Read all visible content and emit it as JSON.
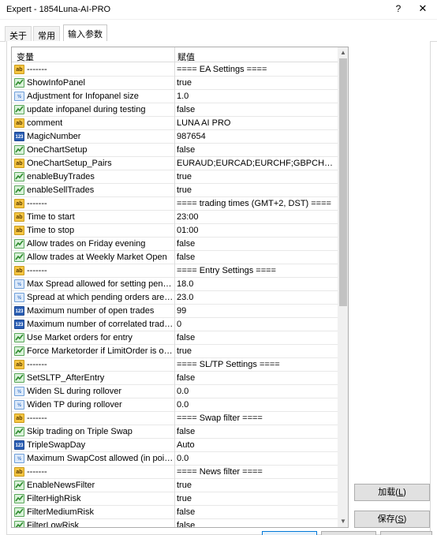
{
  "window": {
    "title": "Expert - 1854Luna-AI-PRO",
    "help_label": "?",
    "close_label": "✕"
  },
  "tabs": [
    {
      "label": "关于",
      "active": false
    },
    {
      "label": "常用",
      "active": false
    },
    {
      "label": "输入参数",
      "active": true
    }
  ],
  "grid": {
    "col_name": "变量",
    "col_value": "赋值",
    "rows": [
      {
        "type": "ab",
        "name": "-------",
        "value": "==== EA Settings ===="
      },
      {
        "type": "bool",
        "name": "ShowInfoPanel",
        "value": "true"
      },
      {
        "type": "dbl",
        "name": "Adjustment for Infopanel size",
        "value": "1.0"
      },
      {
        "type": "bool",
        "name": "update infopanel during testing",
        "value": "false"
      },
      {
        "type": "ab",
        "name": "comment",
        "value": "LUNA AI PRO"
      },
      {
        "type": "int",
        "name": "MagicNumber",
        "value": "987654"
      },
      {
        "type": "bool",
        "name": "OneChartSetup",
        "value": "false"
      },
      {
        "type": "ab",
        "name": "OneChartSetup_Pairs",
        "value": "EURAUD;EURCAD;EURCHF;GBPCHF;AUDU..."
      },
      {
        "type": "bool",
        "name": "enableBuyTrades",
        "value": "true"
      },
      {
        "type": "bool",
        "name": "enableSellTrades",
        "value": "true"
      },
      {
        "type": "ab",
        "name": "-------",
        "value": "==== trading times (GMT+2, DST) ===="
      },
      {
        "type": "ab",
        "name": "Time to start",
        "value": "23:00"
      },
      {
        "type": "ab",
        "name": "Time to stop",
        "value": "01:00"
      },
      {
        "type": "bool",
        "name": "Allow trades on Friday evening",
        "value": "false"
      },
      {
        "type": "bool",
        "name": "Allow trades at Weekly Market Open",
        "value": "false"
      },
      {
        "type": "ab",
        "name": "-------",
        "value": "==== Entry Settings ===="
      },
      {
        "type": "dbl",
        "name": "Max Spread allowed for setting pendi...",
        "value": "18.0"
      },
      {
        "type": "dbl",
        "name": "Spread at which pending orders are d...",
        "value": "23.0"
      },
      {
        "type": "int",
        "name": "Maximum number of open trades",
        "value": "99"
      },
      {
        "type": "int",
        "name": "Maximum number of correlated trade...",
        "value": "0"
      },
      {
        "type": "bool",
        "name": "Use Market orders for entry",
        "value": "false"
      },
      {
        "type": "bool",
        "name": "Force Marketorder if LimitOrder is ou...",
        "value": "true"
      },
      {
        "type": "ab",
        "name": "-------",
        "value": "==== SL/TP Settings ===="
      },
      {
        "type": "bool",
        "name": "SetSLTP_AfterEntry",
        "value": "false"
      },
      {
        "type": "dbl",
        "name": "Widen SL during rollover",
        "value": "0.0"
      },
      {
        "type": "dbl",
        "name": "Widen TP during rollover",
        "value": "0.0"
      },
      {
        "type": "ab",
        "name": "-------",
        "value": "==== Swap filter ===="
      },
      {
        "type": "bool",
        "name": "Skip trading on Triple Swap",
        "value": "false"
      },
      {
        "type": "int",
        "name": "TripleSwapDay",
        "value": "Auto"
      },
      {
        "type": "dbl",
        "name": "Maximum SwapCost allowed (in points)",
        "value": "0.0"
      },
      {
        "type": "ab",
        "name": "-------",
        "value": "==== News filter ===="
      },
      {
        "type": "bool",
        "name": "EnableNewsFilter",
        "value": "true"
      },
      {
        "type": "bool",
        "name": "FilterHighRisk",
        "value": "true"
      },
      {
        "type": "bool",
        "name": "FilterMediumRisk",
        "value": "false"
      },
      {
        "type": "bool",
        "name": "FilterLowRisk",
        "value": "false"
      }
    ]
  },
  "buttons": {
    "load_label": "加载(",
    "load_key": "L",
    "load_suffix": ")",
    "save_label": "保存(",
    "save_key": "S",
    "save_suffix": ")"
  },
  "icons": {
    "ab_text": "ab",
    "dbl_text": "½",
    "int_text": "123"
  },
  "colors": {
    "primary_border": "#0078d7",
    "scroll_thumb": "#c2c2c2"
  }
}
